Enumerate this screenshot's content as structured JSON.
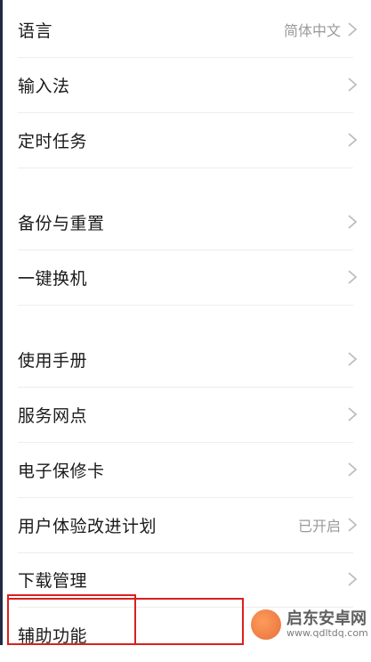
{
  "settings": {
    "items": [
      {
        "label": "语言",
        "value": "简体中文"
      },
      {
        "label": "输入法",
        "value": ""
      },
      {
        "label": "定时任务",
        "value": ""
      },
      {
        "label": "备份与重置",
        "value": ""
      },
      {
        "label": "一键换机",
        "value": ""
      },
      {
        "label": "使用手册",
        "value": ""
      },
      {
        "label": "服务网点",
        "value": ""
      },
      {
        "label": "电子保修卡",
        "value": ""
      },
      {
        "label": "用户体验改进计划",
        "value": "已开启"
      },
      {
        "label": "下载管理",
        "value": ""
      },
      {
        "label": "辅助功能",
        "value": ""
      }
    ]
  },
  "watermark": {
    "title": "启东安卓网",
    "url": "www.qdltdq.com"
  },
  "colors": {
    "highlight": "#d9201f",
    "chevron": "#bdbdbd"
  }
}
